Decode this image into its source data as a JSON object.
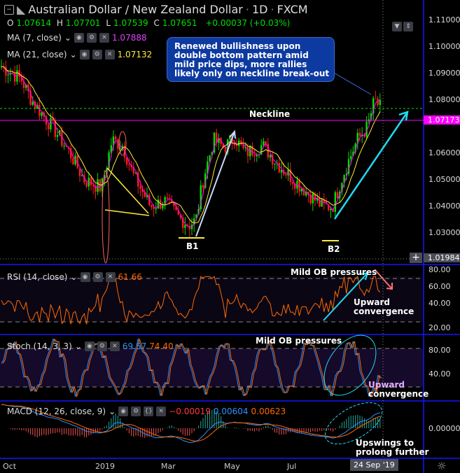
{
  "header": {
    "title": "Australian Dollar / New Zealand Dollar",
    "interval": "1D",
    "source": "FXCM",
    "open": "1.07614",
    "high": "1.07701",
    "low": "1.07539",
    "close": "1.07651",
    "change": "+0.00037 (+0.03%)"
  },
  "indicators": {
    "ma7": {
      "label": "MA (7, close)",
      "value": "1.07888",
      "color": "#e040fb"
    },
    "ma21": {
      "label": "MA (21, close)",
      "value": "1.07132",
      "color": "#ffeb3b"
    },
    "rsi": {
      "label": "RSI (14, close)",
      "value": "61.66"
    },
    "stoch": {
      "label": "Stoch (14, 3, 3)",
      "k": "69.57",
      "d": "74.40"
    },
    "macd": {
      "label": "MACD (12, 26, close, 9)",
      "hist": "−0.00019",
      "macd": "0.00604",
      "signal": "0.00623"
    }
  },
  "annotations": {
    "callout": [
      "Renewed bullishness upon",
      "double bottom pattern amid",
      "mild price dips, more rallies",
      "likely only on neckline break-out"
    ],
    "neckline": "Neckline",
    "b1": "B1",
    "b2": "B2",
    "rsi_ob": "Mild OB pressures",
    "rsi_conv": [
      "Upward",
      "convergence"
    ],
    "stoch_ob": "Mild OB pressures",
    "stoch_conv": [
      "Upward",
      "convergence"
    ],
    "macd_note": [
      "Upswings to",
      "prolong further"
    ]
  },
  "price_axis": {
    "ticks": [
      "1.11000",
      "1.10000",
      "1.09000",
      "1.08000",
      "1.06000",
      "1.05000",
      "1.04000",
      "1.03000"
    ],
    "neckline_price": "1.07173",
    "cursor_price": "1.01984"
  },
  "rsi_axis": [
    "80.00",
    "60.00",
    "40.00",
    "20.00"
  ],
  "stoch_axis": [
    "80.00",
    "40.00"
  ],
  "macd_axis": [
    "0.00000"
  ],
  "time_axis": {
    "labels": [
      "Oct",
      "2019",
      "Mar",
      "May",
      "Jul",
      "Se"
    ],
    "cursor": "24 Sep '19"
  },
  "chart_data": {
    "type": "candlestick",
    "x": [
      0,
      30,
      45,
      80,
      100,
      120,
      145,
      160,
      175,
      190,
      215,
      235,
      255,
      270,
      280,
      290,
      305,
      320,
      335,
      350,
      375,
      400,
      420,
      440,
      460,
      475,
      490,
      510,
      525,
      535,
      545
    ],
    "close": [
      1.093,
      1.088,
      1.08,
      1.068,
      1.06,
      1.05,
      1.047,
      1.065,
      1.063,
      1.052,
      1.04,
      1.042,
      1.036,
      1.033,
      1.035,
      1.05,
      1.065,
      1.062,
      1.066,
      1.06,
      1.063,
      1.055,
      1.05,
      1.045,
      1.04,
      1.04,
      1.052,
      1.065,
      1.07,
      1.08,
      1.0765
    ]
  },
  "colors": {
    "up": "#00e000",
    "down": "#ff1a1a",
    "accent": "#1515ff",
    "rsi": "#ff6a00",
    "stochK": "#2f8fff",
    "neck": "#ff00ff"
  }
}
